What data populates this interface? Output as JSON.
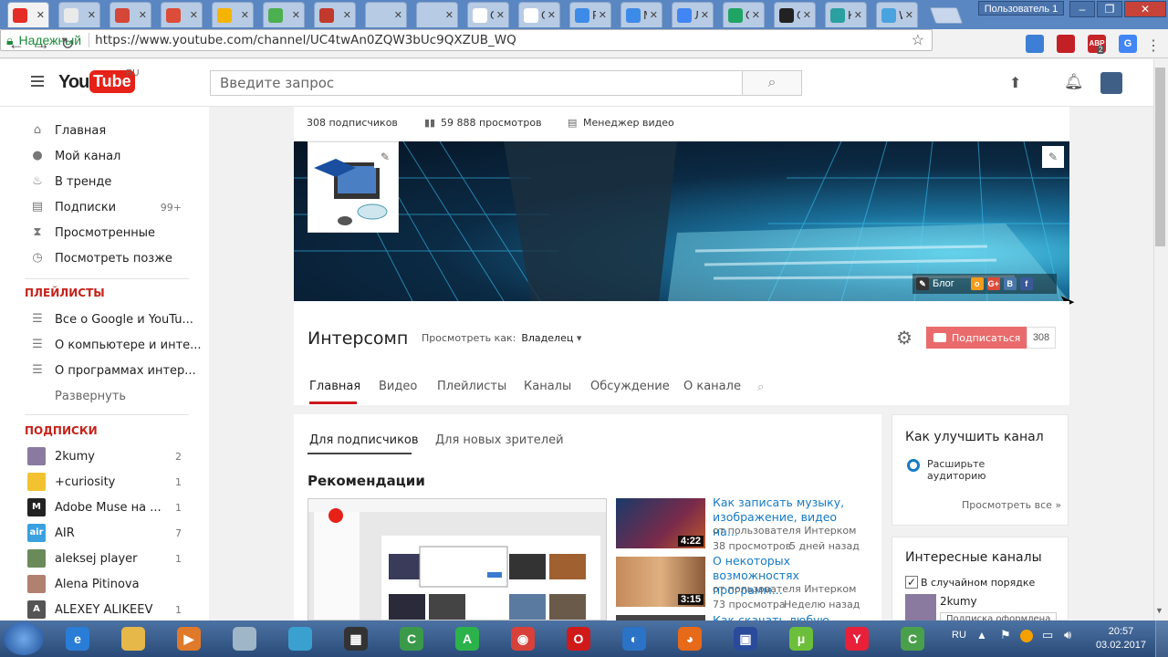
{
  "browser": {
    "tabs": [
      {
        "icon": "youtube-icon",
        "color": "#e52d27",
        "label": "",
        "active": true
      },
      {
        "icon": "page-icon",
        "color": "#eaeaea",
        "label": ""
      },
      {
        "icon": "gmail-icon",
        "color": "#d44638",
        "label": ""
      },
      {
        "icon": "google-plus-icon",
        "color": "#dd4b39",
        "label": ""
      },
      {
        "icon": "mail-icon",
        "color": "#f5b400",
        "label": ""
      },
      {
        "icon": "puzzle-icon",
        "color": "#4caf50",
        "label": ""
      },
      {
        "icon": "seal-icon",
        "color": "#c0392b",
        "label": ""
      },
      {
        "icon": "yandex-icon",
        "color": "#fff0",
        "label": ""
      },
      {
        "icon": "yandex-icon",
        "color": "#fff0",
        "label": ""
      },
      {
        "icon": "google-icon",
        "color": "#fff",
        "label": "О"
      },
      {
        "icon": "google-icon",
        "color": "#fff",
        "label": "О"
      },
      {
        "icon": "dropbox-icon",
        "color": "#3d8be8",
        "label": "Ра"
      },
      {
        "icon": "dropbox-icon",
        "color": "#3d8be8",
        "label": "М"
      },
      {
        "icon": "docs-icon",
        "color": "#4285f4",
        "label": "Ли"
      },
      {
        "icon": "u-icon",
        "color": "#1fa463",
        "label": "Ог"
      },
      {
        "icon": "fb-icon",
        "color": "#222",
        "label": "Ог"
      },
      {
        "icon": "leaf-icon",
        "color": "#2aa0a0",
        "label": "Ку"
      },
      {
        "icon": "w-icon",
        "color": "#4aa3df",
        "label": "W"
      }
    ],
    "profile": "Пользователь 1",
    "url": "https://www.youtube.com/channel/UC4twAn0ZQW3bUc9QXZUB_WQ",
    "secure_label": "Надежный",
    "extensions": [
      {
        "icon": "sync-icon",
        "color": "#3d7fd6",
        "text": ""
      },
      {
        "icon": "pdf-icon",
        "color": "#c32026",
        "text": ""
      },
      {
        "icon": "abp-icon",
        "color": "#c5262a",
        "text": "ABP"
      },
      {
        "icon": "translate-icon",
        "color": "#4285f4",
        "text": "G"
      }
    ],
    "abp_badge": "2"
  },
  "youtube": {
    "logo_you": "You",
    "logo_tube": "Tube",
    "logo_region": "RU",
    "search_placeholder": "Введите запрос"
  },
  "sidebar": {
    "nav": [
      {
        "icon": "home-icon",
        "glyph": "⌂",
        "label": "Главная",
        "count": ""
      },
      {
        "icon": "user-icon",
        "glyph": "●",
        "label": "Мой канал",
        "count": ""
      },
      {
        "icon": "fire-icon",
        "glyph": "♨",
        "label": "В тренде",
        "count": ""
      },
      {
        "icon": "subscriptions-icon",
        "glyph": "▤",
        "label": "Подписки",
        "count": "99+"
      },
      {
        "icon": "hourglass-icon",
        "glyph": "⧗",
        "label": "Просмотренные",
        "count": ""
      },
      {
        "icon": "clock-icon",
        "glyph": "◷",
        "label": "Посмотреть позже",
        "count": ""
      }
    ],
    "playlists_heading": "ПЛЕЙЛИСТЫ",
    "playlists": [
      {
        "label": "Все о Google и YouTu..."
      },
      {
        "label": "О компьютере и инте..."
      },
      {
        "label": "О программах интер..."
      }
    ],
    "expand_label": "Развернуть",
    "subscriptions_heading": "ПОДПИСКИ",
    "subscriptions": [
      {
        "label": "2kumy",
        "count": "2",
        "color": "#8a7aa0",
        "letter": ""
      },
      {
        "label": "+curiosity",
        "count": "1",
        "color": "#f2c230",
        "letter": ""
      },
      {
        "label": "Adobe Muse на ...",
        "count": "1",
        "color": "#222",
        "letter": "M"
      },
      {
        "label": "AIR",
        "count": "7",
        "color": "#3aa0e0",
        "letter": "air"
      },
      {
        "label": "aleksej player",
        "count": "1",
        "color": "#6a8a5a",
        "letter": ""
      },
      {
        "label": "Alena Pitinova",
        "count": "",
        "color": "#b08070",
        "letter": ""
      },
      {
        "label": "ALEXEY ALIKEEV",
        "count": "1",
        "color": "#555",
        "letter": "A"
      }
    ]
  },
  "channel": {
    "subscribers": "308 подписчиков",
    "views": "59 888 просмотров",
    "manager": "Менеджер видео",
    "name": "Интерcомп",
    "view_as_label": "Просмотреть как:",
    "view_as_value": "Владелец",
    "subscribe_label": "Подписаться",
    "subscribe_count": "308",
    "blog_label": "Блог",
    "tabs": [
      "Главная",
      "Видео",
      "Плейлисты",
      "Каналы",
      "Обсуждение",
      "О канале"
    ]
  },
  "main": {
    "tabs": [
      "Для подписчиков",
      "Для новых зрителей"
    ],
    "recommendations_title": "Рекомендации",
    "videos": [
      {
        "title": "Как записать музыку, изображение, видео на...",
        "author": "от пользователя Интерком",
        "views": "38 просмотров",
        "date": "5 дней назад",
        "duration": "4:22"
      },
      {
        "title": "О некоторых возможностях программ...",
        "author": "от пользователя Интерком",
        "views": "73 просмотра",
        "date": "Неделю назад",
        "duration": "3:15"
      },
      {
        "title": "Как скачать любую музыку",
        "author": "",
        "views": "",
        "date": "",
        "duration": ""
      }
    ]
  },
  "cards": {
    "improve_title": "Как улучшить канал",
    "improve_item": "Расширьте аудиторию",
    "view_all": "Просмотреть все »",
    "interesting_title": "Интересные каналы",
    "random_label": "В случайном порядке",
    "channel": "2kumy",
    "subscribed_btn": "Подписка оформлена"
  },
  "taskbar": {
    "apps": [
      {
        "icon": "ie-icon",
        "color": "#2a7dd6",
        "glyph": "e"
      },
      {
        "icon": "folder-icon",
        "color": "#e6b84a",
        "glyph": ""
      },
      {
        "icon": "media-player-icon",
        "color": "#e07a2a",
        "glyph": "▶"
      },
      {
        "icon": "disc-icon",
        "color": "#9fb6c8",
        "glyph": ""
      },
      {
        "icon": "globe-icon",
        "color": "#3aa0d0",
        "glyph": ""
      },
      {
        "icon": "film-icon",
        "color": "#333",
        "glyph": "▦"
      },
      {
        "icon": "camtasia-icon",
        "color": "#3a9a4a",
        "glyph": "C"
      },
      {
        "icon": "a-icon",
        "color": "#2cb24a",
        "glyph": "A"
      },
      {
        "icon": "chrome-icon",
        "color": "#d8413a",
        "glyph": "◉"
      },
      {
        "icon": "opera-icon",
        "color": "#d01a1a",
        "glyph": "O"
      },
      {
        "icon": "edge-icon",
        "color": "#2a73c6",
        "glyph": "◐"
      },
      {
        "icon": "firefox-icon",
        "color": "#e66a1a",
        "glyph": "◕"
      },
      {
        "icon": "floppy-icon",
        "color": "#2a4b9a",
        "glyph": "▣"
      },
      {
        "icon": "utorrent-icon",
        "color": "#6cbf3a",
        "glyph": "μ"
      },
      {
        "icon": "yandex-browser-icon",
        "color": "#e8203a",
        "glyph": "Y"
      },
      {
        "icon": "camtasia-recorder-icon",
        "color": "#4aa04a",
        "glyph": "C"
      }
    ],
    "lang": "RU",
    "time": "20:57",
    "date": "03.02.2017"
  }
}
